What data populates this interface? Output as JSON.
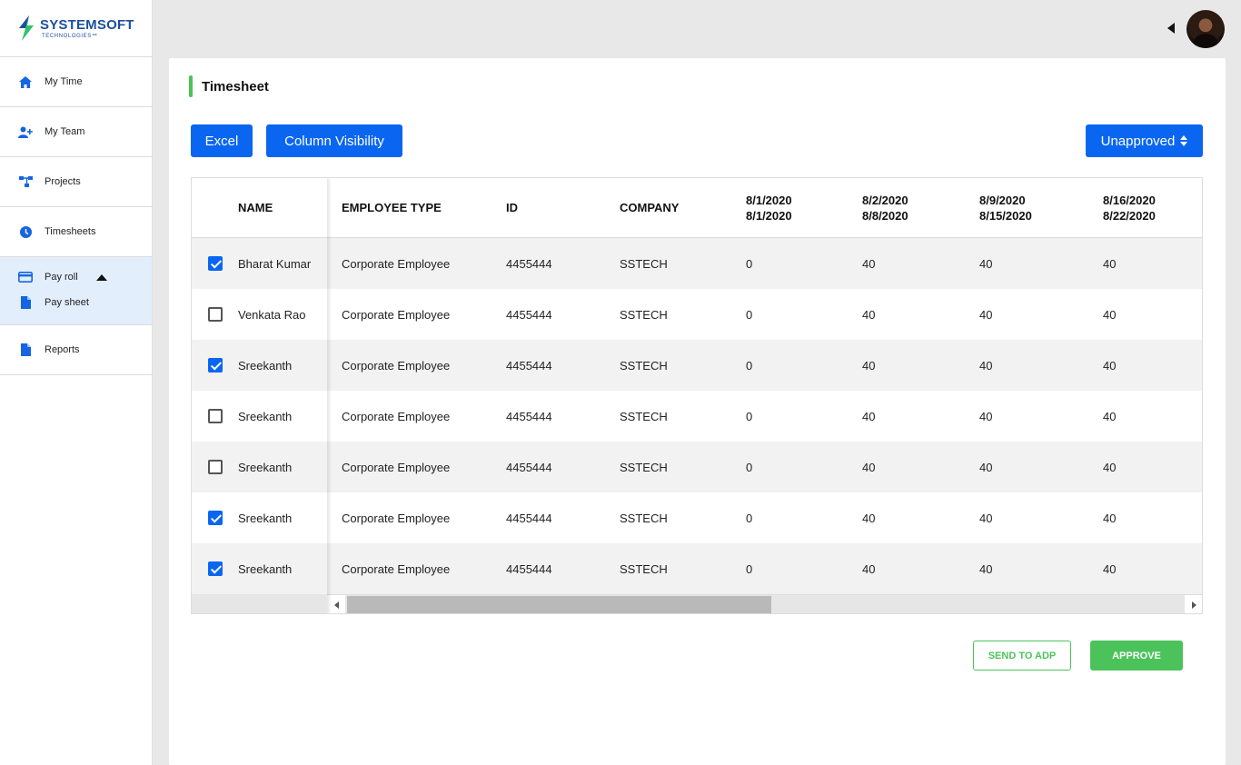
{
  "brand": {
    "name": "SYSTEMSOFT",
    "sub": "TECHNOLOGIES™",
    "colors": {
      "primary": "#0a66f0",
      "accent_green": "#4cc35a",
      "logo_blue": "#1c4fa0",
      "logo_green": "#2fc36a"
    }
  },
  "sidebar": {
    "items": [
      {
        "label": "My Time",
        "icon": "home-icon"
      },
      {
        "label": "My Team",
        "icon": "add-user-icon"
      },
      {
        "label": "Projects",
        "icon": "hierarchy-icon"
      },
      {
        "label": "Timesheets",
        "icon": "clock-icon"
      }
    ],
    "group": {
      "label": "Pay roll",
      "icon": "credit-card-icon",
      "expanded": true,
      "children": [
        {
          "label": "Pay sheet",
          "icon": "document-icon"
        }
      ]
    },
    "after": [
      {
        "label": "Reports",
        "icon": "document-icon"
      }
    ]
  },
  "header": {
    "avatar": "user-avatar"
  },
  "page": {
    "title": "Timesheet",
    "toolbar": {
      "excel_label": "Excel",
      "column_visibility_label": "Column Visibility",
      "filter_label": "Unapproved"
    }
  },
  "table": {
    "fixed_header": "NAME",
    "headers": [
      {
        "line1": "EMPLOYEE TYPE",
        "line2": ""
      },
      {
        "line1": "ID",
        "line2": ""
      },
      {
        "line1": "COMPANY",
        "line2": ""
      },
      {
        "line1": "8/1/2020",
        "line2": "8/1/2020"
      },
      {
        "line1": "8/2/2020",
        "line2": "8/8/2020"
      },
      {
        "line1": "8/9/2020",
        "line2": "8/15/2020"
      },
      {
        "line1": "8/16/2020",
        "line2": "8/22/2020"
      }
    ],
    "rows": [
      {
        "checked": true,
        "name": "Bharat Kumar",
        "type": "Corporate Employee",
        "id": "4455444",
        "company": "SSTECH",
        "w1": "0",
        "w2": "40",
        "w3": "40",
        "w4": "40"
      },
      {
        "checked": false,
        "name": "Venkata Rao",
        "type": "Corporate Employee",
        "id": "4455444",
        "company": "SSTECH",
        "w1": "0",
        "w2": "40",
        "w3": "40",
        "w4": "40"
      },
      {
        "checked": true,
        "name": "Sreekanth",
        "type": "Corporate Employee",
        "id": "4455444",
        "company": "SSTECH",
        "w1": "0",
        "w2": "40",
        "w3": "40",
        "w4": "40"
      },
      {
        "checked": false,
        "name": "Sreekanth",
        "type": "Corporate Employee",
        "id": "4455444",
        "company": "SSTECH",
        "w1": "0",
        "w2": "40",
        "w3": "40",
        "w4": "40"
      },
      {
        "checked": false,
        "name": "Sreekanth",
        "type": "Corporate Employee",
        "id": "4455444",
        "company": "SSTECH",
        "w1": "0",
        "w2": "40",
        "w3": "40",
        "w4": "40"
      },
      {
        "checked": true,
        "name": "Sreekanth",
        "type": "Corporate Employee",
        "id": "4455444",
        "company": "SSTECH",
        "w1": "0",
        "w2": "40",
        "w3": "40",
        "w4": "40"
      },
      {
        "checked": true,
        "name": "Sreekanth",
        "type": "Corporate Employee",
        "id": "4455444",
        "company": "SSTECH",
        "w1": "0",
        "w2": "40",
        "w3": "40",
        "w4": "40"
      }
    ]
  },
  "actions": {
    "send_label": "SEND TO ADP",
    "approve_label": "APPROVE"
  }
}
